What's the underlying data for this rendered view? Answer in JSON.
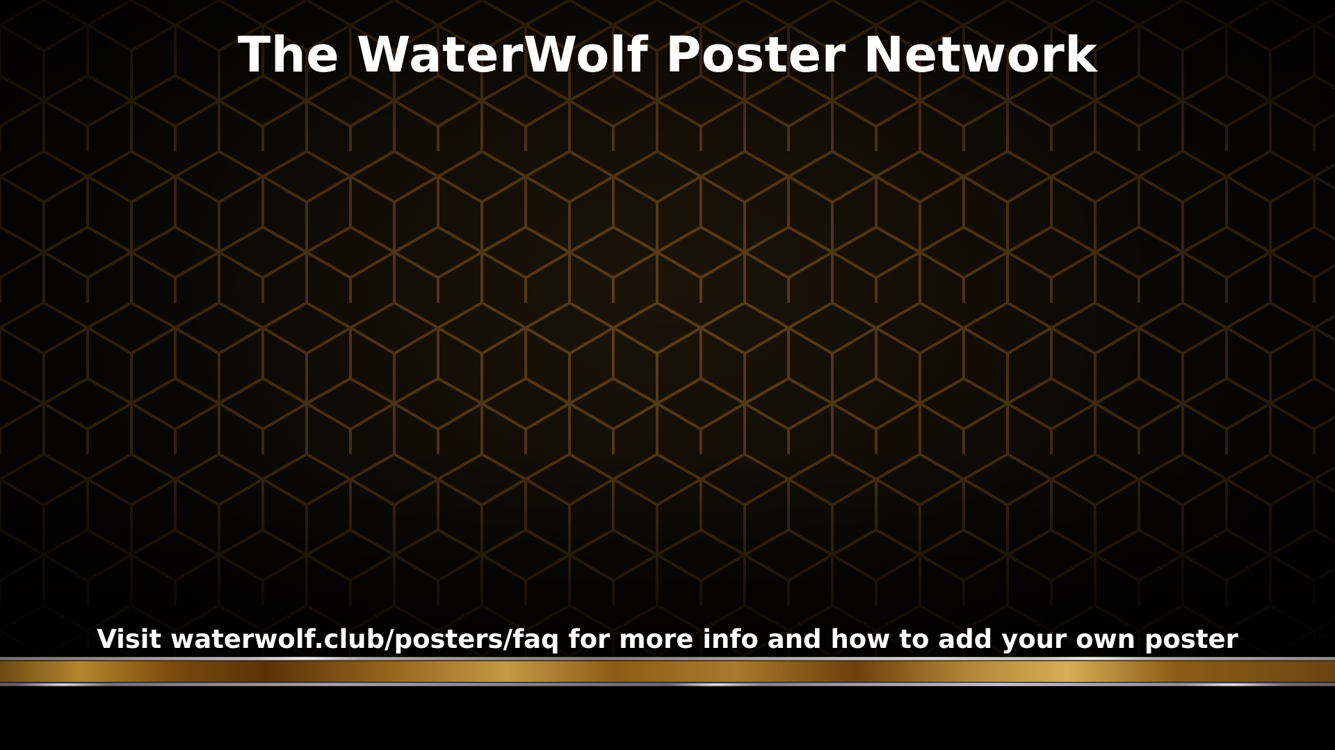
{
  "poster": {
    "title": "The WaterWolf Poster Network",
    "footer": "Visit waterwolf.club/posters/faq for more info and how to add your own poster"
  },
  "colors": {
    "background": "#000000",
    "pattern_lines": "#6b4a1c",
    "gold_band": "#b4862e",
    "text": "#ffffff"
  }
}
